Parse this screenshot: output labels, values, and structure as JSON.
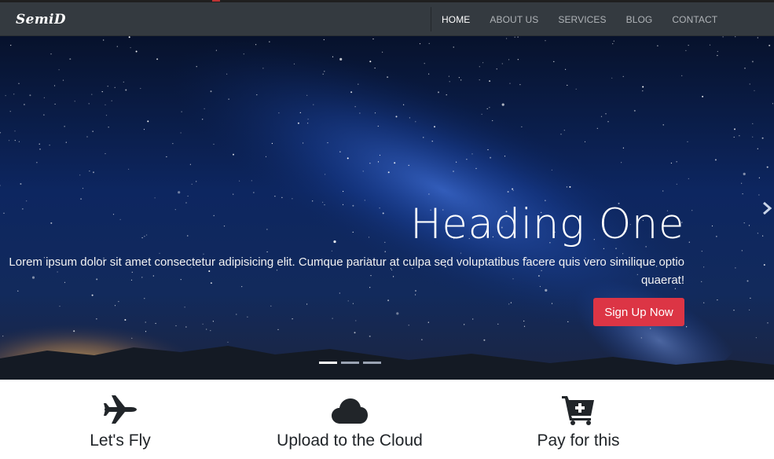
{
  "brand": "SemiD",
  "nav": {
    "home": "HOME",
    "about": "ABOUT US",
    "services": "SERVICES",
    "blog": "BLOG",
    "contact": "CONTACT"
  },
  "hero": {
    "heading": "Heading One",
    "text": "Lorem ipsum dolor sit amet consectetur adipisicing elit. Cumque pariatur at culpa sed voluptatibus facere quis vero similique optio quaerat!",
    "button": "Sign Up Now",
    "next_icon": "chevron-right",
    "slides_total": 3,
    "active_slide": 1
  },
  "features": [
    {
      "label": "Let's Fly",
      "icon": "plane-icon"
    },
    {
      "label": "Upload to the Cloud",
      "icon": "cloud-icon"
    },
    {
      "label": "Pay for this",
      "icon": "cart-plus-icon"
    }
  ],
  "colors": {
    "navbar": "#343a40",
    "accent": "#dc3545"
  }
}
